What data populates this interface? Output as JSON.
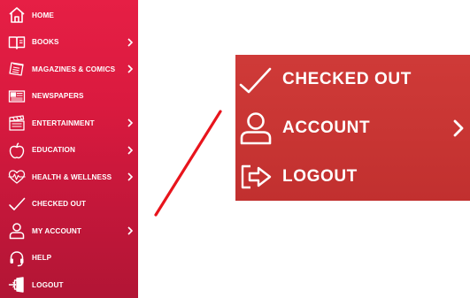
{
  "colors": {
    "sidebar_top": "#e61f45",
    "sidebar_bottom": "#b21535",
    "zoom_panel": "#c83533",
    "text": "#ffffff",
    "connector": "#e8141c"
  },
  "sidebar": {
    "items": [
      {
        "label": "HOME",
        "icon": "home-icon",
        "has_chevron": false
      },
      {
        "label": "BOOKS",
        "icon": "book-icon",
        "has_chevron": true
      },
      {
        "label": "MAGAZINES & COMICS",
        "icon": "magazine-icon",
        "has_chevron": true
      },
      {
        "label": "NEWSPAPERS",
        "icon": "newspaper-icon",
        "has_chevron": false
      },
      {
        "label": "ENTERTAINMENT",
        "icon": "clapperboard-icon",
        "has_chevron": true
      },
      {
        "label": "EDUCATION",
        "icon": "apple-icon",
        "has_chevron": true
      },
      {
        "label": "HEALTH & WELLNESS",
        "icon": "heart-pulse-icon",
        "has_chevron": true
      },
      {
        "label": "CHECKED OUT",
        "icon": "checkmark-icon",
        "has_chevron": false
      },
      {
        "label": "MY ACCOUNT",
        "icon": "user-icon",
        "has_chevron": true
      },
      {
        "label": "HELP",
        "icon": "headset-icon",
        "has_chevron": false
      },
      {
        "label": "LOGOUT",
        "icon": "logout-door-icon",
        "has_chevron": false
      }
    ]
  },
  "zoom": {
    "items": [
      {
        "label": "CHECKED OUT",
        "icon": "checkmark-icon",
        "has_chevron": false
      },
      {
        "label": "ACCOUNT",
        "icon": "user-icon",
        "has_chevron": true
      },
      {
        "label": "LOGOUT",
        "icon": "logout-arrow-icon",
        "has_chevron": false
      }
    ]
  }
}
